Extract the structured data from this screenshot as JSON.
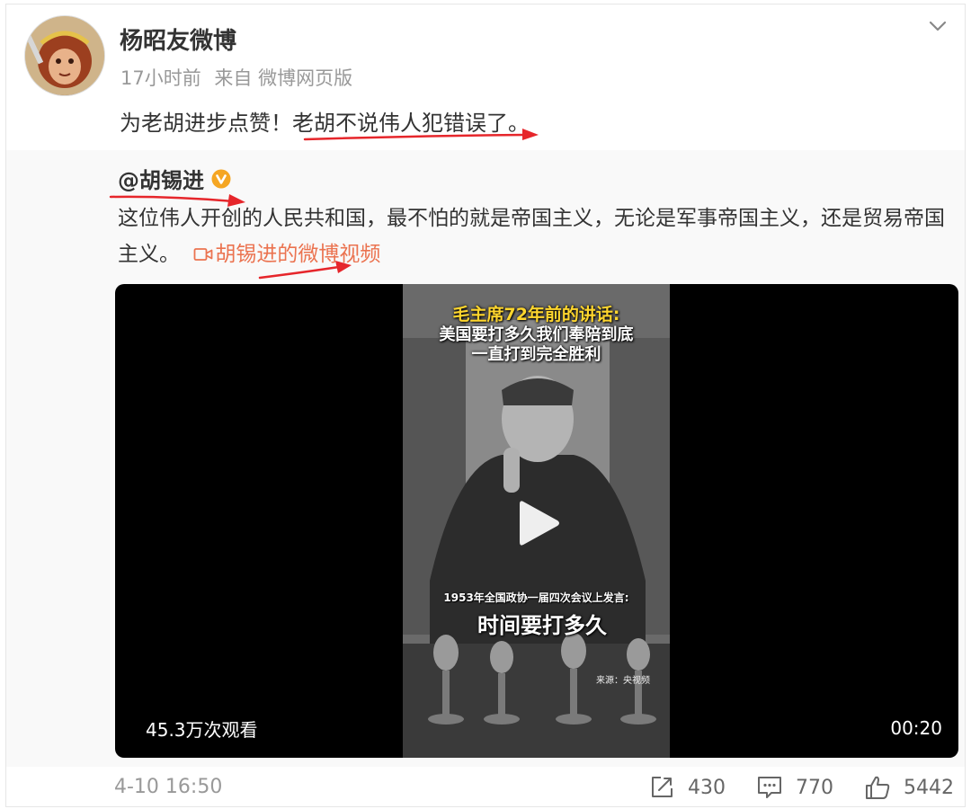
{
  "post": {
    "author": "杨昭友微博",
    "time": "17小时前",
    "source": "来自 微博网页版",
    "text": "为老胡进步点赞！老胡不说伟人犯错误了。"
  },
  "repost": {
    "author": "@胡锡进",
    "text": "这位伟人开创的人民共和国，最不怕的就是帝国主义，无论是军事帝国主义，还是贸易帝国主义。",
    "video_link": "胡锡进的微博视频"
  },
  "video": {
    "caption_title": "毛主席72年前的讲话:",
    "caption_line2": "美国要打多久我们奉陪到底",
    "caption_line3": "一直打到完全胜利",
    "caption_sub": "1953年全国政协一届四次会议上发言:",
    "caption_main": "时间要打多久",
    "caption_source": "来源：央视频",
    "views": "45.3万次观看",
    "duration": "00:20"
  },
  "footer": {
    "timestamp": "4-10 16:50",
    "share_count": "430",
    "comment_count": "770",
    "like_count": "5442"
  },
  "icons": {
    "chevron": "chevron-down-icon",
    "verified": "verified-badge-icon",
    "video": "video-camera-icon",
    "play": "play-icon",
    "share": "share-icon",
    "comment": "comment-icon",
    "like": "thumbs-up-icon"
  },
  "colors": {
    "link": "#eb7350",
    "badge": "#f5a623",
    "arrow": "#e6262b",
    "caption_yellow": "#ffd62e"
  }
}
